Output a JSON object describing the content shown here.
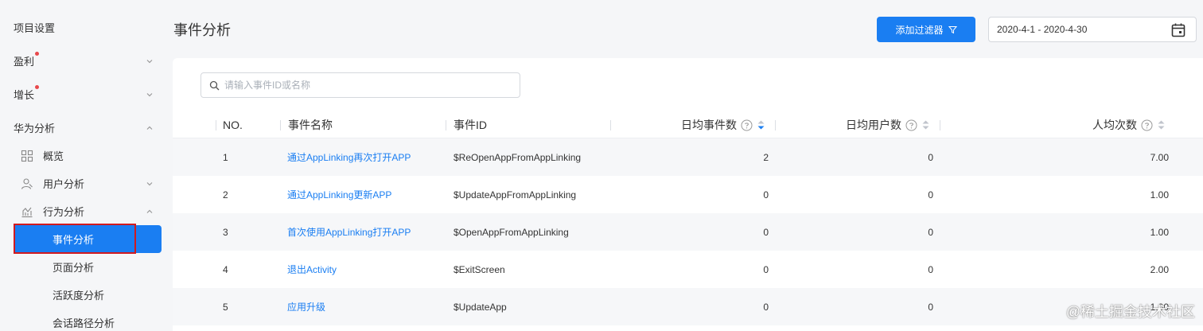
{
  "sidebar": {
    "project_settings": "项目设置",
    "profit": "盈利",
    "growth": "增长",
    "huawei_analytics": "华为分析",
    "overview": "概览",
    "user_analysis": "用户分析",
    "behavior_analysis": "行为分析",
    "event_analysis": "事件分析",
    "page_analysis": "页面分析",
    "activity_analysis": "活跃度分析",
    "session_path_analysis": "会话路径分析"
  },
  "header": {
    "title": "事件分析",
    "filter_button": "添加过滤器",
    "date_range": "2020-4-1 - 2020-4-30"
  },
  "search": {
    "placeholder": "请输入事件ID或名称"
  },
  "table": {
    "columns": {
      "no": "NO.",
      "event_name": "事件名称",
      "event_id": "事件ID",
      "daily_events": "日均事件数",
      "daily_users": "日均用户数",
      "avg_per_user": "人均次数"
    },
    "rows": [
      {
        "no": "1",
        "name": "通过AppLinking再次打开APP",
        "id": "$ReOpenAppFromAppLinking",
        "daily_events": "2",
        "daily_users": "0",
        "avg": "7.00"
      },
      {
        "no": "2",
        "name": "通过AppLinking更新APP",
        "id": "$UpdateAppFromAppLinking",
        "daily_events": "0",
        "daily_users": "0",
        "avg": "1.00"
      },
      {
        "no": "3",
        "name": "首次使用AppLinking打开APP",
        "id": "$OpenAppFromAppLinking",
        "daily_events": "0",
        "daily_users": "0",
        "avg": "1.00"
      },
      {
        "no": "4",
        "name": "退出Activity",
        "id": "$ExitScreen",
        "daily_events": "0",
        "daily_users": "0",
        "avg": "2.00"
      },
      {
        "no": "5",
        "name": "应用升级",
        "id": "$UpdateApp",
        "daily_events": "0",
        "daily_users": "0",
        "avg": "1.00"
      }
    ]
  },
  "watermark": "@稀土掘金技术社区",
  "colors": {
    "accent": "#1a7ef2",
    "highlight_border": "#d11a1f",
    "badge_dot": "#e8484b"
  }
}
